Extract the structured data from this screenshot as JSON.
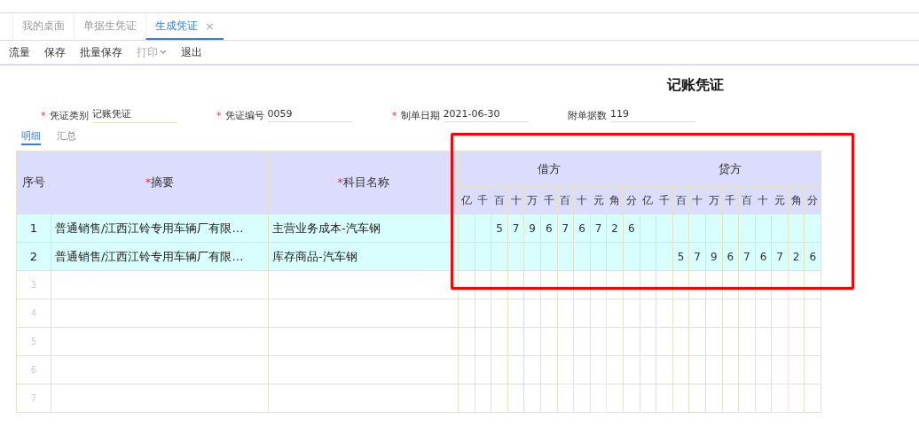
{
  "tabs": [
    {
      "label": "我的桌面",
      "selected": false
    },
    {
      "label": "单据生凭证",
      "selected": false
    },
    {
      "label": "生成凭证",
      "selected": true,
      "close": "×"
    }
  ],
  "toolbar": [
    {
      "label": "流量",
      "disabled": false,
      "dropdown": false
    },
    {
      "label": "保存",
      "disabled": false,
      "dropdown": false
    },
    {
      "label": "批量保存",
      "disabled": false,
      "dropdown": false
    },
    {
      "label": "打印",
      "disabled": true,
      "dropdown": true
    },
    {
      "label": "退出",
      "disabled": false,
      "dropdown": false
    }
  ],
  "voucher_title": "记账凭证",
  "fields": [
    {
      "mark": "*",
      "label": "凭证类别",
      "value": "记账凭证"
    },
    {
      "mark": "*",
      "label": "凭证编号",
      "value": "0059"
    },
    {
      "mark": "*",
      "label": "制单日期",
      "value": "2021-06-30"
    },
    {
      "label": "附单据数",
      "value": "119"
    }
  ],
  "subtabs": [
    {
      "label": "明细",
      "selected": true
    },
    {
      "label": "汇总",
      "selected": false
    }
  ],
  "table": {
    "columns": [
      {
        "label": "序号"
      },
      {
        "mark": "*",
        "label": "摘要"
      },
      {
        "mark": "*",
        "label": "科目名称"
      }
    ],
    "debit_label": "借方",
    "credit_label": "贷方",
    "debit_units": [
      "亿",
      "千",
      "百",
      "十",
      "万",
      "千",
      "百",
      "十",
      "元",
      "角",
      "分"
    ],
    "credit_units": [
      "亿",
      "千",
      "百",
      "十",
      "万",
      "千",
      "百",
      "十",
      "元",
      "角",
      "分"
    ],
    "rows": [
      {
        "seq": "1",
        "summary": "普通销售/江西江铃专用车辆厂有限…",
        "account": "主营业务成本-汽车钢",
        "debit": [
          "5",
          "7",
          "9",
          "6",
          "7",
          "6",
          "7",
          "2",
          "6"
        ],
        "filled": true
      },
      {
        "seq": "2",
        "summary": "普通销售/江西江铃专用车辆厂有限…",
        "account": "库存商品-汽车钢",
        "credit": [
          "5",
          "7",
          "9",
          "6",
          "7",
          "6",
          "7",
          "2",
          "6"
        ],
        "filled": true
      },
      {
        "seq": "3",
        "filled": false
      },
      {
        "seq": "4",
        "filled": false
      },
      {
        "seq": "5",
        "filled": false
      },
      {
        "seq": "6",
        "filled": false
      },
      {
        "seq": "7",
        "filled": false
      }
    ]
  }
}
